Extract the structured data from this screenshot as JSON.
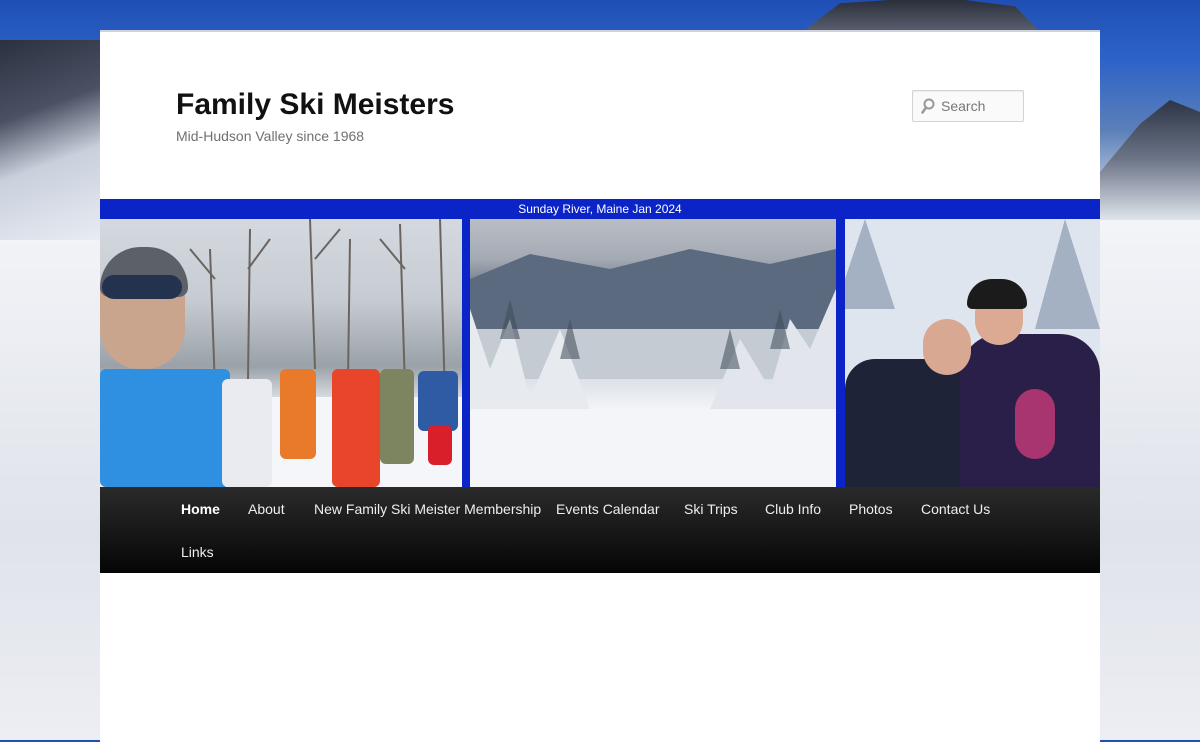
{
  "site": {
    "title": "Family Ski Meisters",
    "tagline": "Mid-Hudson Valley since 1968"
  },
  "search": {
    "placeholder": "Search"
  },
  "banner": {
    "caption": "Sunday River, Maine Jan 2024",
    "accent": "#0a24c8"
  },
  "nav": {
    "items": [
      {
        "label": "Home",
        "active": true
      },
      {
        "label": "About"
      },
      {
        "label": "New Family Ski Meister Membership"
      },
      {
        "label": "Events Calendar"
      },
      {
        "label": "Ski Trips"
      },
      {
        "label": "Club Info"
      },
      {
        "label": "Photos"
      },
      {
        "label": "Contact Us"
      },
      {
        "label": "Links"
      }
    ]
  }
}
